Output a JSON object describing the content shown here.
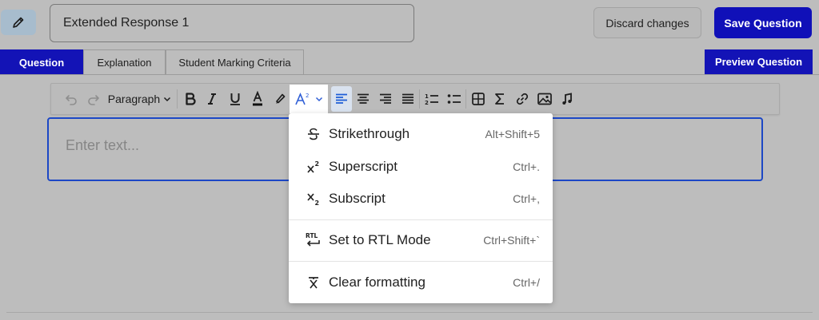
{
  "header": {
    "title_value": "Extended Response 1",
    "discard_label": "Discard changes",
    "save_label": "Save Question"
  },
  "tabs": [
    {
      "label": "Question",
      "active": true
    },
    {
      "label": "Explanation",
      "active": false
    },
    {
      "label": "Student Marking Criteria",
      "active": false
    }
  ],
  "preview_label": "Preview Question",
  "toolbar": {
    "block_format": "Paragraph",
    "icons": [
      "undo-icon",
      "redo-icon",
      "bold-icon",
      "italic-icon",
      "underline-icon",
      "text-color-icon",
      "highlight-icon",
      "superscript-menu-icon",
      "align-left-icon",
      "align-center-icon",
      "align-right-icon",
      "justify-icon",
      "numbered-list-icon",
      "bullet-list-icon",
      "table-icon",
      "sigma-icon",
      "link-icon",
      "image-icon",
      "music-icon"
    ]
  },
  "editor": {
    "placeholder": "Enter text..."
  },
  "format_menu": {
    "items": [
      {
        "label": "Strikethrough",
        "shortcut": "Alt+Shift+5",
        "icon": "strikethrough-icon"
      },
      {
        "label": "Superscript",
        "shortcut": "Ctrl+.",
        "icon": "superscript-icon"
      },
      {
        "label": "Subscript",
        "shortcut": "Ctrl+,",
        "icon": "subscript-icon"
      },
      {
        "label": "Set to RTL Mode",
        "shortcut": "Ctrl+Shift+`",
        "icon": "rtl-icon"
      },
      {
        "label": "Clear formatting",
        "shortcut": "Ctrl+/",
        "icon": "clear-format-icon"
      }
    ]
  },
  "colors": {
    "primary": "#1313b6",
    "editor_border": "#1c47c5",
    "background": "#bdbdbd"
  }
}
